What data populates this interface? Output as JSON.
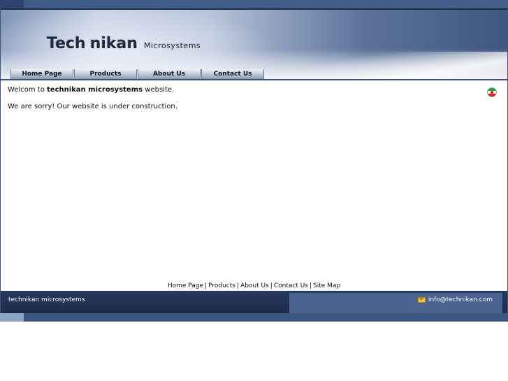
{
  "header": {
    "logo_part1": "Tech",
    "logo_part2": "nikan",
    "logo_sub": "Microsystems"
  },
  "nav": {
    "items": [
      {
        "label": "Home Page"
      },
      {
        "label": "Products"
      },
      {
        "label": "About Us"
      },
      {
        "label": "Contact Us"
      }
    ]
  },
  "content": {
    "welcome_pre": "Welcom to",
    "welcome_bold": "technikan microsystems",
    "welcome_post": "website.",
    "notice": "We are sorry! Our website is under construction."
  },
  "footer": {
    "links": [
      "Home Page",
      "Products",
      "About Us",
      "Contact Us",
      "Site Map"
    ],
    "separator": "|",
    "company": "technikan microsystems",
    "email": "info@technikan.com"
  },
  "icons": {
    "language_flag": "flag-icon",
    "mail": "mail-icon"
  }
}
